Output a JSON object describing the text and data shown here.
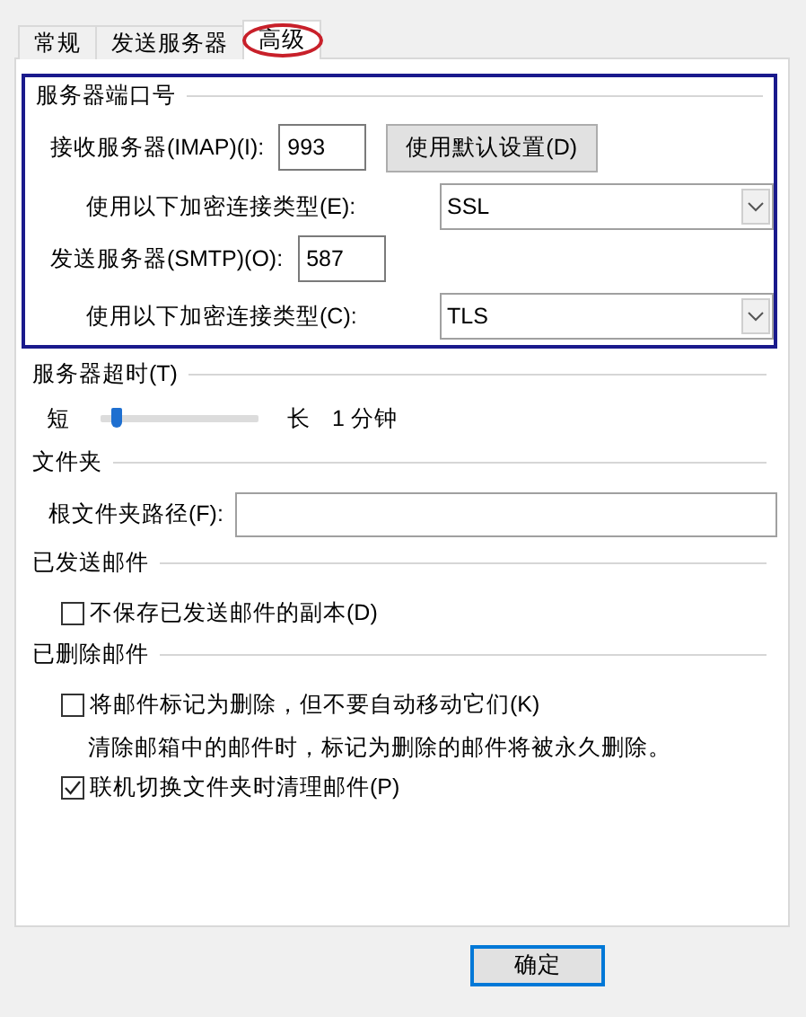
{
  "tabs": [
    {
      "label": "常规",
      "selected": false,
      "circled": false
    },
    {
      "label": "发送服务器",
      "selected": false,
      "circled": false
    },
    {
      "label": "高级",
      "selected": true,
      "circled": true
    }
  ],
  "sections": [
    {
      "title": "服务器端口号",
      "framed": true,
      "rows": [
        {
          "kind": "port",
          "label": "接收服务器(IMAP)(I):",
          "value": "993",
          "button": "使用默认设置(D)"
        },
        {
          "kind": "select",
          "label": "使用以下加密连接类型(E):",
          "value": "SSL"
        },
        {
          "kind": "port",
          "label": "发送服务器(SMTP)(O):",
          "value": "587"
        },
        {
          "kind": "select",
          "label": "使用以下加密连接类型(C):",
          "value": "TLS"
        }
      ]
    },
    {
      "title": "服务器超时(T)",
      "framed": false,
      "rows": [
        {
          "kind": "slider",
          "min_label": "短",
          "max_label": "长",
          "reading": "1 分钟",
          "level": 0.1
        }
      ]
    },
    {
      "title": "文件夹",
      "framed": false,
      "rows": [
        {
          "kind": "path",
          "label": "根文件夹路径(F):"
        }
      ]
    },
    {
      "title": "已发送邮件",
      "framed": false,
      "rows": [
        {
          "kind": "checkbox",
          "label": "不保存已发送邮件的副本(D)",
          "checked": false
        }
      ]
    },
    {
      "title": "已删除邮件",
      "framed": false,
      "rows": [
        {
          "kind": "checkbox",
          "label": "将邮件标记为删除，但不要自动移动它们(K)",
          "checked": false
        },
        {
          "kind": "note",
          "text": "清除邮箱中的邮件时，标记为删除的邮件将被永久删除。"
        },
        {
          "kind": "checkbox",
          "label": "联机切换文件夹时清理邮件(P)",
          "checked": true
        }
      ]
    }
  ],
  "buttons": [
    {
      "label": "确定",
      "default": true
    }
  ]
}
